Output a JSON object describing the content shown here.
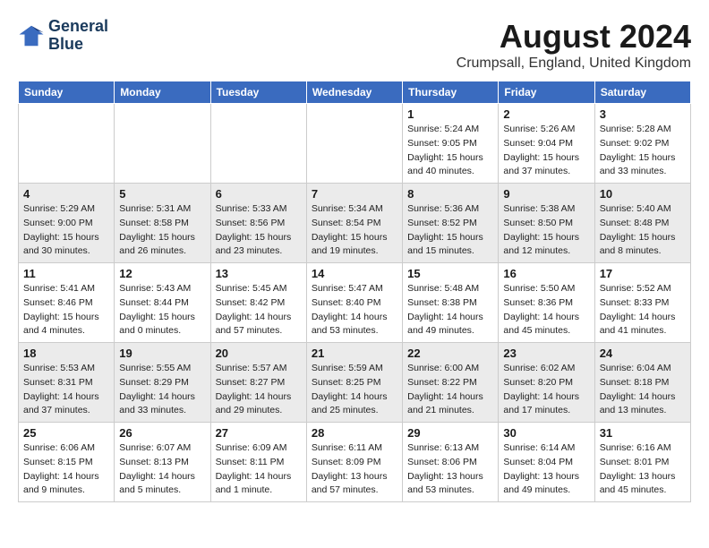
{
  "header": {
    "logo_line1": "General",
    "logo_line2": "Blue",
    "month_year": "August 2024",
    "location": "Crumpsall, England, United Kingdom"
  },
  "weekdays": [
    "Sunday",
    "Monday",
    "Tuesday",
    "Wednesday",
    "Thursday",
    "Friday",
    "Saturday"
  ],
  "weeks": [
    [
      {
        "day": "",
        "info": ""
      },
      {
        "day": "",
        "info": ""
      },
      {
        "day": "",
        "info": ""
      },
      {
        "day": "",
        "info": ""
      },
      {
        "day": "1",
        "info": "Sunrise: 5:24 AM\nSunset: 9:05 PM\nDaylight: 15 hours\nand 40 minutes."
      },
      {
        "day": "2",
        "info": "Sunrise: 5:26 AM\nSunset: 9:04 PM\nDaylight: 15 hours\nand 37 minutes."
      },
      {
        "day": "3",
        "info": "Sunrise: 5:28 AM\nSunset: 9:02 PM\nDaylight: 15 hours\nand 33 minutes."
      }
    ],
    [
      {
        "day": "4",
        "info": "Sunrise: 5:29 AM\nSunset: 9:00 PM\nDaylight: 15 hours\nand 30 minutes."
      },
      {
        "day": "5",
        "info": "Sunrise: 5:31 AM\nSunset: 8:58 PM\nDaylight: 15 hours\nand 26 minutes."
      },
      {
        "day": "6",
        "info": "Sunrise: 5:33 AM\nSunset: 8:56 PM\nDaylight: 15 hours\nand 23 minutes."
      },
      {
        "day": "7",
        "info": "Sunrise: 5:34 AM\nSunset: 8:54 PM\nDaylight: 15 hours\nand 19 minutes."
      },
      {
        "day": "8",
        "info": "Sunrise: 5:36 AM\nSunset: 8:52 PM\nDaylight: 15 hours\nand 15 minutes."
      },
      {
        "day": "9",
        "info": "Sunrise: 5:38 AM\nSunset: 8:50 PM\nDaylight: 15 hours\nand 12 minutes."
      },
      {
        "day": "10",
        "info": "Sunrise: 5:40 AM\nSunset: 8:48 PM\nDaylight: 15 hours\nand 8 minutes."
      }
    ],
    [
      {
        "day": "11",
        "info": "Sunrise: 5:41 AM\nSunset: 8:46 PM\nDaylight: 15 hours\nand 4 minutes."
      },
      {
        "day": "12",
        "info": "Sunrise: 5:43 AM\nSunset: 8:44 PM\nDaylight: 15 hours\nand 0 minutes."
      },
      {
        "day": "13",
        "info": "Sunrise: 5:45 AM\nSunset: 8:42 PM\nDaylight: 14 hours\nand 57 minutes."
      },
      {
        "day": "14",
        "info": "Sunrise: 5:47 AM\nSunset: 8:40 PM\nDaylight: 14 hours\nand 53 minutes."
      },
      {
        "day": "15",
        "info": "Sunrise: 5:48 AM\nSunset: 8:38 PM\nDaylight: 14 hours\nand 49 minutes."
      },
      {
        "day": "16",
        "info": "Sunrise: 5:50 AM\nSunset: 8:36 PM\nDaylight: 14 hours\nand 45 minutes."
      },
      {
        "day": "17",
        "info": "Sunrise: 5:52 AM\nSunset: 8:33 PM\nDaylight: 14 hours\nand 41 minutes."
      }
    ],
    [
      {
        "day": "18",
        "info": "Sunrise: 5:53 AM\nSunset: 8:31 PM\nDaylight: 14 hours\nand 37 minutes."
      },
      {
        "day": "19",
        "info": "Sunrise: 5:55 AM\nSunset: 8:29 PM\nDaylight: 14 hours\nand 33 minutes."
      },
      {
        "day": "20",
        "info": "Sunrise: 5:57 AM\nSunset: 8:27 PM\nDaylight: 14 hours\nand 29 minutes."
      },
      {
        "day": "21",
        "info": "Sunrise: 5:59 AM\nSunset: 8:25 PM\nDaylight: 14 hours\nand 25 minutes."
      },
      {
        "day": "22",
        "info": "Sunrise: 6:00 AM\nSunset: 8:22 PM\nDaylight: 14 hours\nand 21 minutes."
      },
      {
        "day": "23",
        "info": "Sunrise: 6:02 AM\nSunset: 8:20 PM\nDaylight: 14 hours\nand 17 minutes."
      },
      {
        "day": "24",
        "info": "Sunrise: 6:04 AM\nSunset: 8:18 PM\nDaylight: 14 hours\nand 13 minutes."
      }
    ],
    [
      {
        "day": "25",
        "info": "Sunrise: 6:06 AM\nSunset: 8:15 PM\nDaylight: 14 hours\nand 9 minutes."
      },
      {
        "day": "26",
        "info": "Sunrise: 6:07 AM\nSunset: 8:13 PM\nDaylight: 14 hours\nand 5 minutes."
      },
      {
        "day": "27",
        "info": "Sunrise: 6:09 AM\nSunset: 8:11 PM\nDaylight: 14 hours\nand 1 minute."
      },
      {
        "day": "28",
        "info": "Sunrise: 6:11 AM\nSunset: 8:09 PM\nDaylight: 13 hours\nand 57 minutes."
      },
      {
        "day": "29",
        "info": "Sunrise: 6:13 AM\nSunset: 8:06 PM\nDaylight: 13 hours\nand 53 minutes."
      },
      {
        "day": "30",
        "info": "Sunrise: 6:14 AM\nSunset: 8:04 PM\nDaylight: 13 hours\nand 49 minutes."
      },
      {
        "day": "31",
        "info": "Sunrise: 6:16 AM\nSunset: 8:01 PM\nDaylight: 13 hours\nand 45 minutes."
      }
    ]
  ]
}
